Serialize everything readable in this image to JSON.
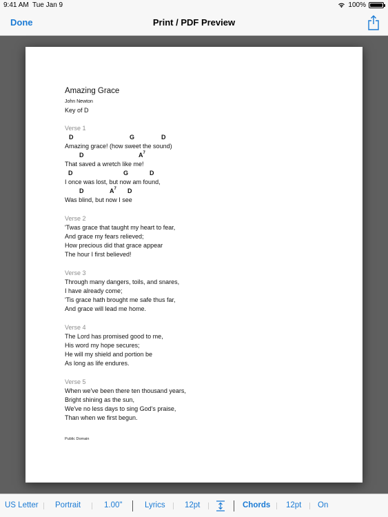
{
  "status_bar": {
    "time": "9:41 AM",
    "date": "Tue Jan 9",
    "battery": "100%"
  },
  "nav": {
    "done_label": "Done",
    "title": "Print / PDF Preview",
    "share_icon": "share-icon"
  },
  "song": {
    "title": "Amazing Grace",
    "author": "John Newton",
    "key": "Key of D",
    "copyright": "Public Domain",
    "sections": [
      {
        "label": "Verse 1",
        "lines": [
          {
            "chords": [
              {
                "c": "D",
                "sup": ""
              },
              {
                "c": "G",
                "sup": ""
              },
              {
                "c": "D",
                "sup": ""
              }
            ],
            "text": "Amazing grace! (how sweet the sound)"
          },
          {
            "chords": [
              {
                "c": "D",
                "sup": ""
              },
              {
                "c": "A",
                "sup": "7"
              }
            ],
            "text": "That saved a wretch like me!"
          },
          {
            "chords": [
              {
                "c": "D",
                "sup": ""
              },
              {
                "c": "G",
                "sup": ""
              },
              {
                "c": "D",
                "sup": ""
              }
            ],
            "text": "I once was lost, but now am found,"
          },
          {
            "chords": [
              {
                "c": "D",
                "sup": ""
              },
              {
                "c": "A",
                "sup": "7"
              },
              {
                "c": "D",
                "sup": ""
              }
            ],
            "text": "Was blind, but now I see"
          }
        ]
      },
      {
        "label": "Verse 2",
        "lines": [
          {
            "text": "'Twas grace that taught my heart to fear,"
          },
          {
            "text": "And grace my fears relieved;"
          },
          {
            "text": "How precious did that grace appear"
          },
          {
            "text": "The hour I first believed!"
          }
        ]
      },
      {
        "label": "Verse 3",
        "lines": [
          {
            "text": "Through many dangers, toils, and snares,"
          },
          {
            "text": "I have already come;"
          },
          {
            "text": "'Tis grace hath brought me safe thus far,"
          },
          {
            "text": "And grace will lead me home."
          }
        ]
      },
      {
        "label": "Verse 4",
        "lines": [
          {
            "text": "The Lord has promised good to me,"
          },
          {
            "text": "His word my hope secures;"
          },
          {
            "text": "He will my shield and portion be"
          },
          {
            "text": "As long as life endures."
          }
        ]
      },
      {
        "label": "Verse 5",
        "lines": [
          {
            "text": "When we've been there ten thousand years,"
          },
          {
            "text": "Bright shining as the sun,"
          },
          {
            "text": "We've no less days to sing God's praise,"
          },
          {
            "text": "Than when we first begun."
          }
        ]
      }
    ]
  },
  "toolbar": {
    "paper_size": "US Letter",
    "orientation": "Portrait",
    "margin": "1.00\"",
    "lyrics_label": "Lyrics",
    "lyrics_size": "12pt",
    "spacing_icon": "line-spacing-icon",
    "chords_label": "Chords",
    "chords_size": "12pt",
    "chords_state": "On"
  },
  "colors": {
    "accent": "#1a7ad4",
    "backdrop": "#5f5f5f",
    "section_label": "#8d8d8d"
  }
}
